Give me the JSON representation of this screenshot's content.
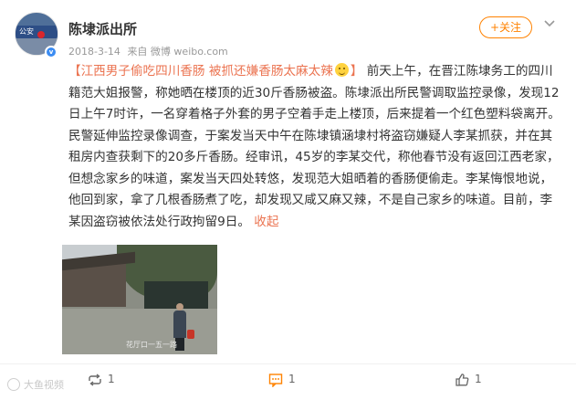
{
  "post": {
    "author": "陈埭派出所",
    "date": "2018-3-14",
    "source": "来自 微博 weibo.com",
    "follow_label": "+关注",
    "avatar_text": "公安",
    "verified_badge": "v"
  },
  "content": {
    "headline": "【江西男子偷吃四川香肠 被抓还嫌香肠太麻太辣",
    "headline_close": "】",
    "body": "前天上午，在晋江陈埭务工的四川籍范大姐报警，称她晒在楼顶的近30斤香肠被盗。陈埭派出所民警调取监控录像，发现12日上午7时许，一名穿着格子外套的男子空着手走上楼顶，后来提着一个红色塑料袋离开。民警延伸监控录像调查，于案发当天中午在陈埭镇涵埭村将盗窃嫌疑人李某抓获，并在其租房内查获剩下的20多斤香肠。经审讯，45岁的李某交代，称他春节没有返回江西老家，但想念家乡的味道，案发当天四处转悠，发现范大姐晒着的香肠便偷走。李某悔恨地说，他回到家，拿了几根香肠煮了吃，却发现又咸又麻又辣，不是自己家乡的味道。目前，李某因盗窃被依法处行政拘留9日。",
    "collapse_label": "收起",
    "emoji_icon": "laughing-face-icon"
  },
  "photo": {
    "caption": "花厅口一五一路"
  },
  "footer": {
    "repost_count": "1",
    "comment_count": "1",
    "like_count": "1"
  },
  "watermark": "大鱼视频",
  "colors": {
    "accent": "#eb7350",
    "follow": "#ff8200",
    "text": "#333333",
    "meta": "#999999"
  }
}
